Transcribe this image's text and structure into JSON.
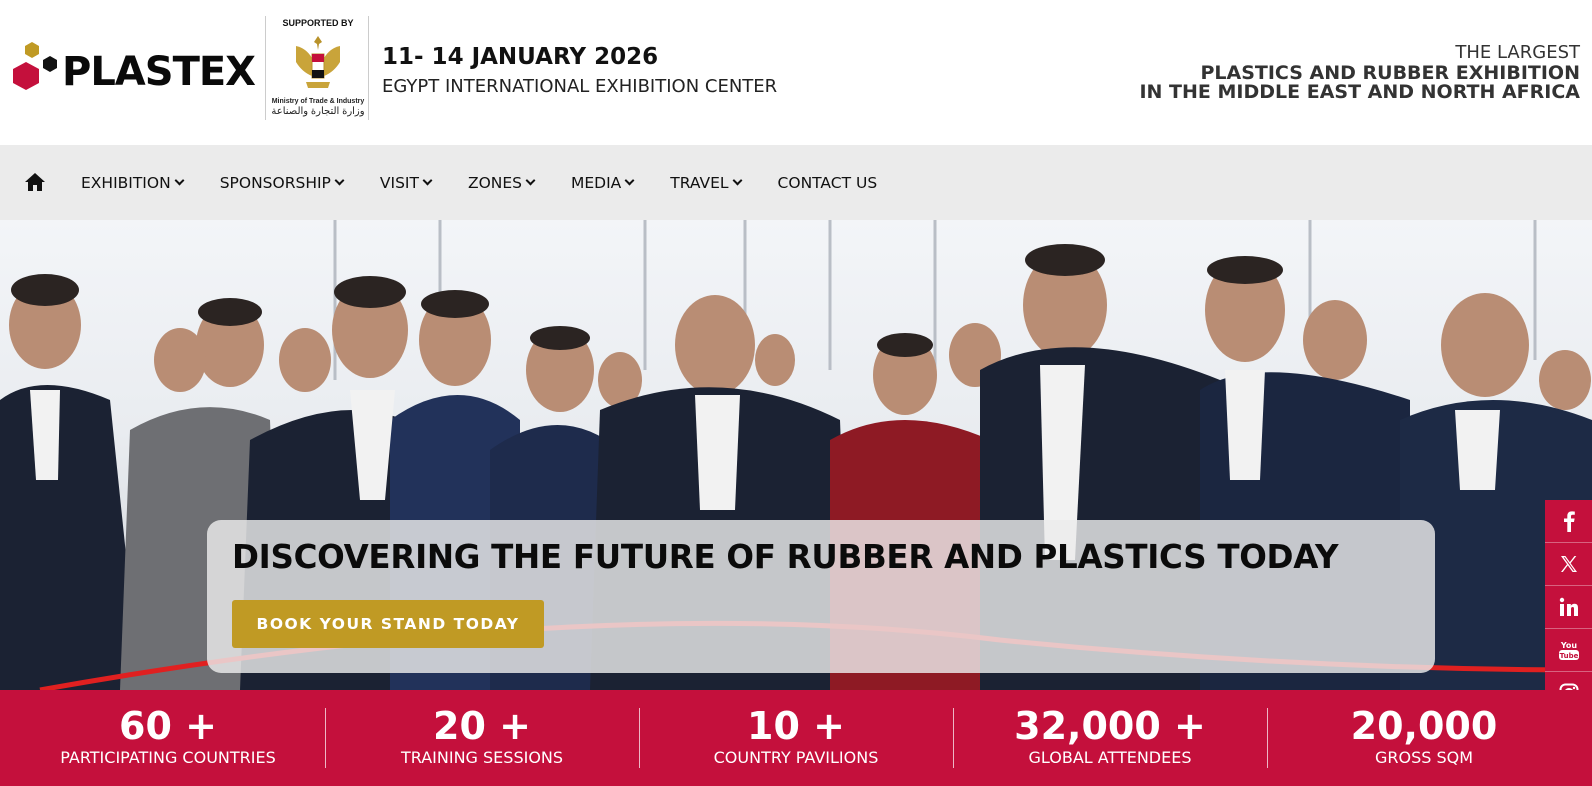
{
  "header": {
    "logo_text": "PLASTEX",
    "supported_by": "SUPPORTED BY",
    "ministry_en": "Ministry of Trade & Industry",
    "ministry_ar": "وزارة التجارة والصناعة",
    "event_date": "11- 14 JANUARY 2026",
    "event_venue": "EGYPT INTERNATIONAL EXHIBITION CENTER",
    "tagline_1": "THE LARGEST",
    "tagline_2": "PLASTICS AND RUBBER EXHIBITION",
    "tagline_3": "IN THE MIDDLE EAST AND NORTH AFRICA"
  },
  "nav": {
    "home_icon": "home-icon",
    "items": [
      {
        "label": "EXHIBITION",
        "dropdown": true
      },
      {
        "label": "SPONSORSHIP",
        "dropdown": true
      },
      {
        "label": "VISIT",
        "dropdown": true
      },
      {
        "label": "ZONES",
        "dropdown": true
      },
      {
        "label": "MEDIA",
        "dropdown": true
      },
      {
        "label": "TRAVEL",
        "dropdown": true
      },
      {
        "label": "CONTACT US",
        "dropdown": false
      }
    ]
  },
  "hero": {
    "headline": "DISCOVERING THE FUTURE OF RUBBER AND PLASTICS TODAY",
    "cta_label": "BOOK YOUR STAND TODAY"
  },
  "social": {
    "icons": [
      "facebook-icon",
      "x-icon",
      "linkedin-icon",
      "youtube-icon",
      "instagram-icon"
    ]
  },
  "stats": [
    {
      "value": "60 +",
      "label": "PARTICIPATING COUNTRIES"
    },
    {
      "value": "20 +",
      "label": "TRAINING SESSIONS"
    },
    {
      "value": "10 +",
      "label": "COUNTRY PAVILIONS"
    },
    {
      "value": "32,000 +",
      "label": "GLOBAL ATTENDEES"
    },
    {
      "value": "20,000",
      "label": "GROSS SQM"
    }
  ],
  "colors": {
    "brand_red": "#c4103c",
    "cta_gold": "#c09a24",
    "nav_bg": "#ebebeb"
  }
}
